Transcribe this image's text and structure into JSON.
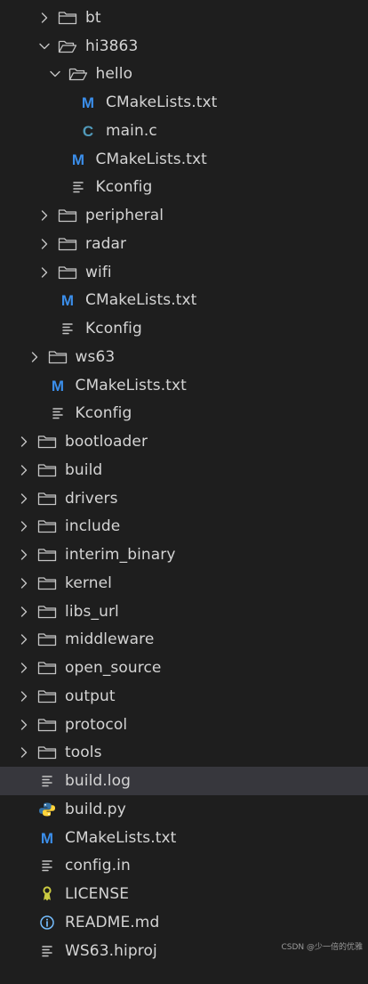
{
  "colors": {
    "background": "#1e1e1e",
    "selected_row": "#37373d",
    "text": "#d4d4d4",
    "cmake_icon": "#3b8eea",
    "c_icon": "#519aba",
    "python_blue": "#3572a5",
    "python_yellow": "#ffd43b",
    "license_icon": "#cbcb41",
    "info_icon": "#75beff"
  },
  "explorer": {
    "items": [
      {
        "label": "bt",
        "type": "folder",
        "expanded": false,
        "depth": 3
      },
      {
        "label": "hi3863",
        "type": "folder",
        "expanded": true,
        "depth": 3
      },
      {
        "label": "hello",
        "type": "folder",
        "expanded": true,
        "depth": 4
      },
      {
        "label": "CMakeLists.txt",
        "type": "cmake",
        "depth": 5
      },
      {
        "label": "main.c",
        "type": "c",
        "depth": 5
      },
      {
        "label": "CMakeLists.txt",
        "type": "cmake",
        "depth": 4
      },
      {
        "label": "Kconfig",
        "type": "text",
        "depth": 4
      },
      {
        "label": "peripheral",
        "type": "folder",
        "expanded": false,
        "depth": 3
      },
      {
        "label": "radar",
        "type": "folder",
        "expanded": false,
        "depth": 3
      },
      {
        "label": "wifi",
        "type": "folder",
        "expanded": false,
        "depth": 3
      },
      {
        "label": "CMakeLists.txt",
        "type": "cmake",
        "depth": 3
      },
      {
        "label": "Kconfig",
        "type": "text",
        "depth": 3
      },
      {
        "label": "ws63",
        "type": "folder",
        "expanded": false,
        "depth": 2
      },
      {
        "label": "CMakeLists.txt",
        "type": "cmake",
        "depth": 2
      },
      {
        "label": "Kconfig",
        "type": "text",
        "depth": 2
      },
      {
        "label": "bootloader",
        "type": "folder",
        "expanded": false,
        "depth": 1
      },
      {
        "label": "build",
        "type": "folder",
        "expanded": false,
        "depth": 1
      },
      {
        "label": "drivers",
        "type": "folder",
        "expanded": false,
        "depth": 1
      },
      {
        "label": "include",
        "type": "folder",
        "expanded": false,
        "depth": 1
      },
      {
        "label": "interim_binary",
        "type": "folder",
        "expanded": false,
        "depth": 1
      },
      {
        "label": "kernel",
        "type": "folder",
        "expanded": false,
        "depth": 1
      },
      {
        "label": "libs_url",
        "type": "folder",
        "expanded": false,
        "depth": 1
      },
      {
        "label": "middleware",
        "type": "folder",
        "expanded": false,
        "depth": 1
      },
      {
        "label": "open_source",
        "type": "folder",
        "expanded": false,
        "depth": 1
      },
      {
        "label": "output",
        "type": "folder",
        "expanded": false,
        "depth": 1
      },
      {
        "label": "protocol",
        "type": "folder",
        "expanded": false,
        "depth": 1
      },
      {
        "label": "tools",
        "type": "folder",
        "expanded": false,
        "depth": 1
      },
      {
        "label": "build.log",
        "type": "text",
        "depth": 1,
        "selected": true
      },
      {
        "label": "build.py",
        "type": "python",
        "depth": 1
      },
      {
        "label": "CMakeLists.txt",
        "type": "cmake",
        "depth": 1
      },
      {
        "label": "config.in",
        "type": "text",
        "depth": 1
      },
      {
        "label": "LICENSE",
        "type": "license",
        "depth": 1
      },
      {
        "label": "README.md",
        "type": "info",
        "depth": 1
      },
      {
        "label": "WS63.hiproj",
        "type": "text",
        "depth": 1
      }
    ]
  },
  "watermark": "CSDN @少一倍的优雅"
}
